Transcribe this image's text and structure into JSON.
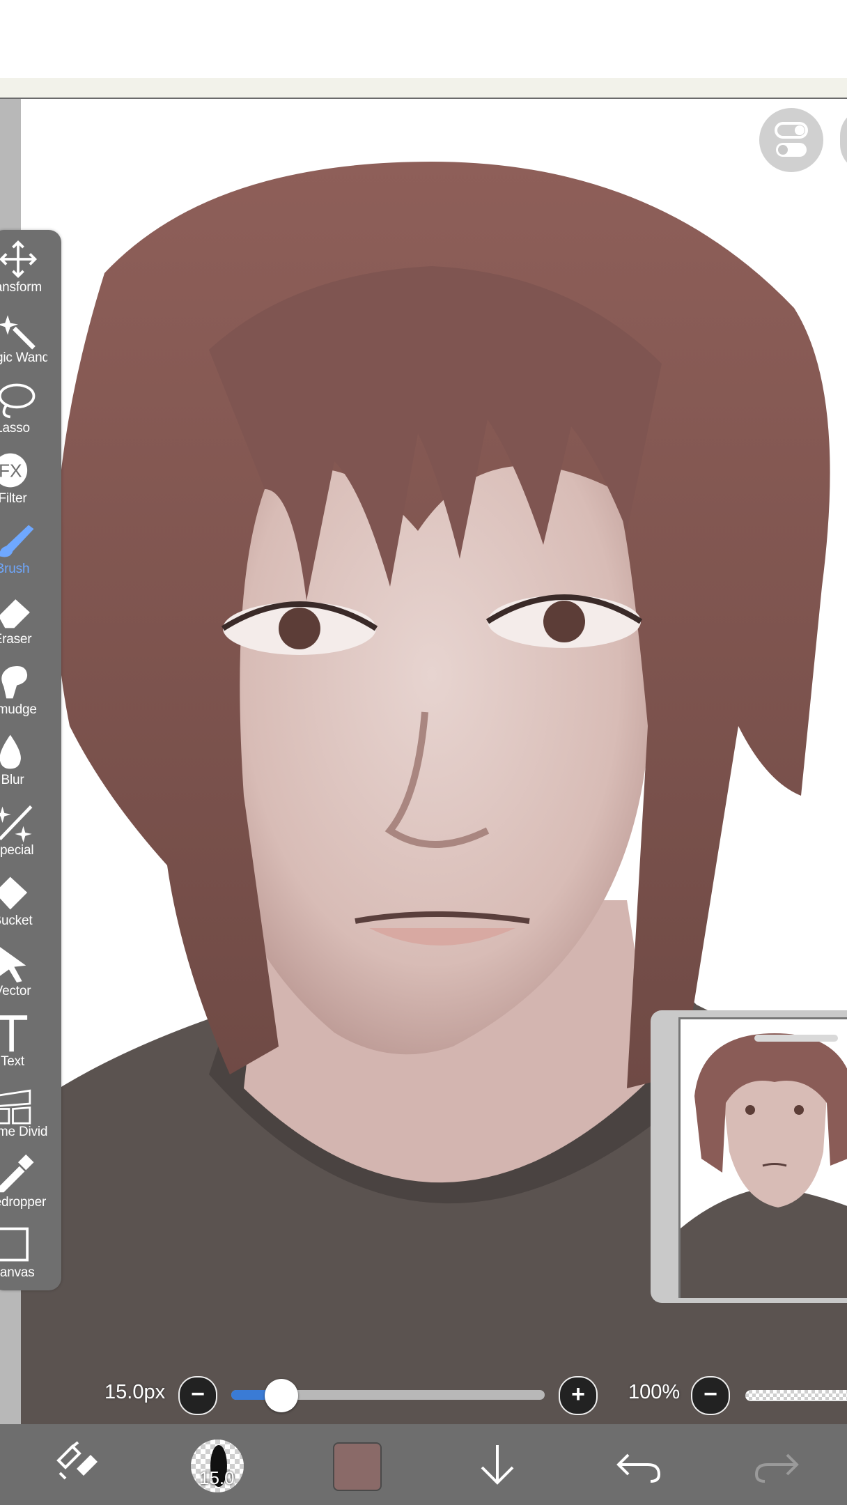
{
  "tools": [
    {
      "id": "transform",
      "label": "Transform",
      "icon": "move-arrows-icon"
    },
    {
      "id": "magic-wand",
      "label": "Magic Wand",
      "icon": "magic-wand-icon"
    },
    {
      "id": "lasso",
      "label": "Lasso",
      "icon": "lasso-icon"
    },
    {
      "id": "filter",
      "label": "Filter",
      "icon": "fx-icon"
    },
    {
      "id": "brush",
      "label": "Brush",
      "icon": "brush-icon",
      "active": true
    },
    {
      "id": "eraser",
      "label": "Eraser",
      "icon": "eraser-icon"
    },
    {
      "id": "smudge",
      "label": "Smudge",
      "icon": "smudge-finger-icon"
    },
    {
      "id": "blur",
      "label": "Blur",
      "icon": "blur-drop-icon"
    },
    {
      "id": "special",
      "label": "Special",
      "icon": "special-sparkle-icon"
    },
    {
      "id": "bucket",
      "label": "Bucket",
      "icon": "bucket-icon"
    },
    {
      "id": "vector",
      "label": "Vector",
      "icon": "vector-cursor-icon"
    },
    {
      "id": "text",
      "label": "Text",
      "icon": "text-icon"
    },
    {
      "id": "frame-divider",
      "label": "Frame Divider",
      "icon": "frame-divider-icon"
    },
    {
      "id": "eyedropper",
      "label": "Eyedropper",
      "icon": "eyedropper-icon"
    },
    {
      "id": "canvas",
      "label": "Canvas",
      "icon": "canvas-icon"
    }
  ],
  "brush_size": {
    "label": "15.0px",
    "value": 15.0,
    "level": 0.16,
    "minus": "−",
    "plus": "+"
  },
  "opacity": {
    "label": "100%",
    "level": 1.0,
    "minus": "−"
  },
  "bottom_bar": {
    "brush_preview_size": "15.0",
    "current_color": "#8a6a68",
    "icons": [
      "quick-select-icon",
      "brush-preview-icon",
      "color-swatch",
      "download-arrow-icon",
      "undo-icon",
      "redo-icon"
    ]
  },
  "colors": {
    "accent": "#3a7bd5",
    "active_tool": "#6fa8ff",
    "palette_bg": "#6f6f6f",
    "toolbar_bg": "#6e6e6e"
  }
}
